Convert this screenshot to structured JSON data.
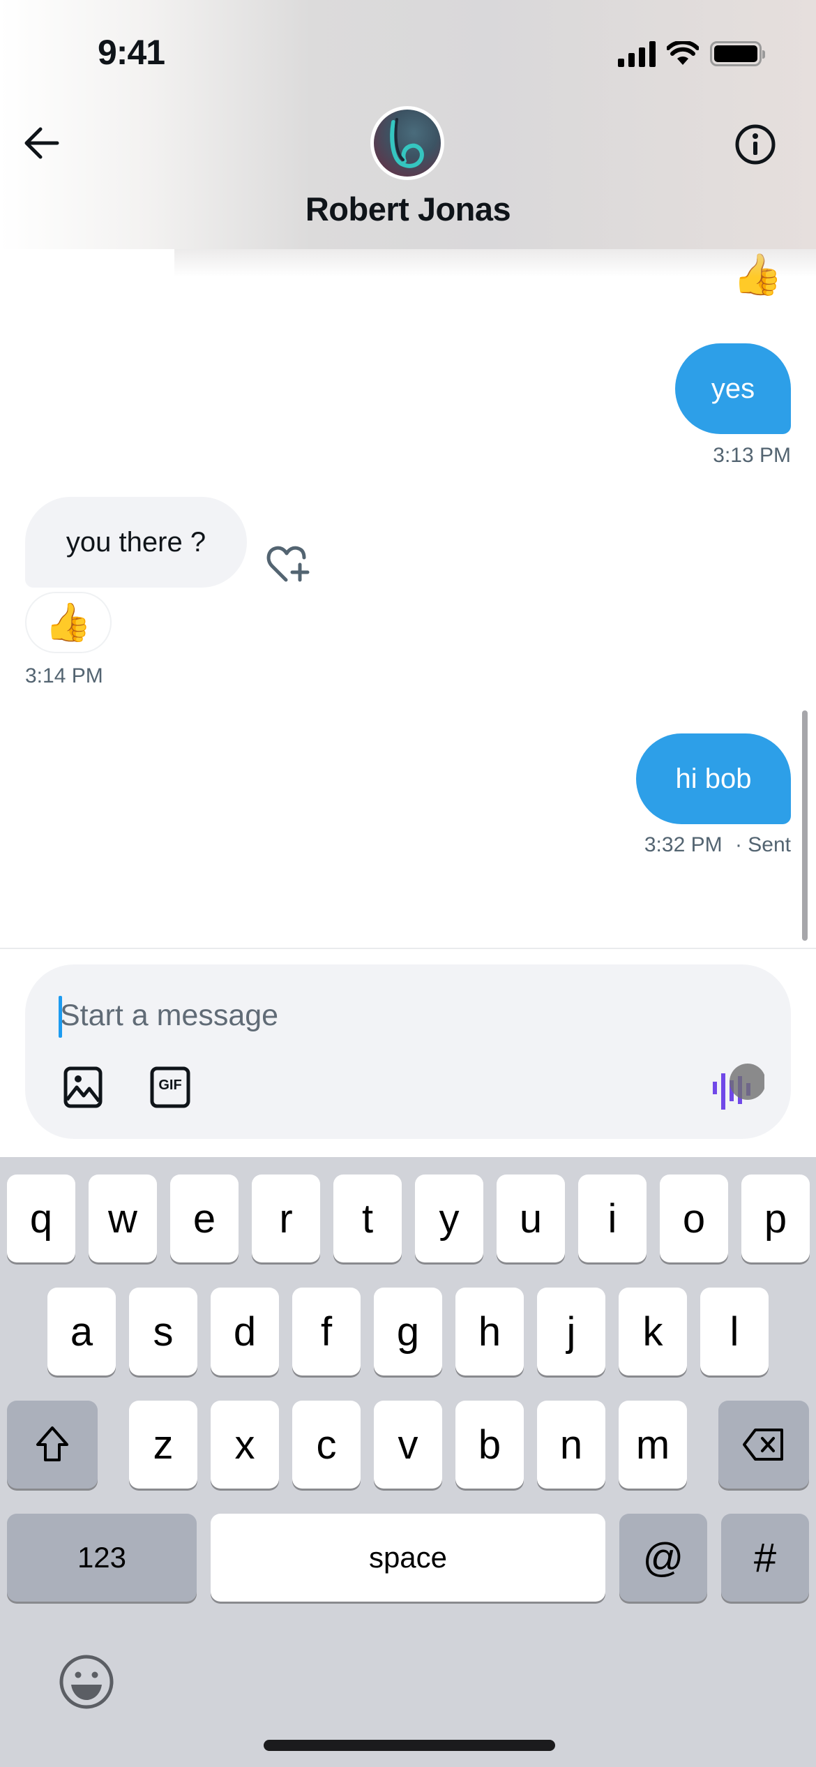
{
  "status_bar": {
    "time": "9:41",
    "icons": [
      "cellular-signal-icon",
      "wifi-icon",
      "battery-icon"
    ]
  },
  "header": {
    "contact_name": "Robert Jonas",
    "back_icon": "arrow-left-icon",
    "info_icon": "info-circle-icon",
    "avatar": "contact-avatar"
  },
  "conversation": {
    "top_reaction": "👍",
    "messages": [
      {
        "direction": "outgoing",
        "text": "yes",
        "time": "3:13 PM"
      },
      {
        "direction": "incoming",
        "text": "you there ?",
        "reaction": "👍",
        "time": "3:14 PM",
        "reaction_action_icon": "heart-plus-icon"
      },
      {
        "direction": "outgoing",
        "text": "hi bob",
        "time": "3:32 PM",
        "status": "· Sent"
      }
    ]
  },
  "composer": {
    "placeholder": "Start a message",
    "value": "",
    "media_icon": "image-icon",
    "gif_label": "GIF",
    "voice_icon": "voice-waveform-icon"
  },
  "keyboard": {
    "row1": [
      "q",
      "w",
      "e",
      "r",
      "t",
      "y",
      "u",
      "i",
      "o",
      "p"
    ],
    "row2": [
      "a",
      "s",
      "d",
      "f",
      "g",
      "h",
      "j",
      "k",
      "l"
    ],
    "row3": [
      "z",
      "x",
      "c",
      "v",
      "b",
      "n",
      "m"
    ],
    "shift_icon": "shift-arrow-icon",
    "delete_icon": "backspace-icon",
    "numbers_label": "123",
    "space_label": "space",
    "at_label": "@",
    "hash_label": "#",
    "emoji_icon": "emoji-face-icon"
  },
  "colors": {
    "accent_blue": "#2d9fe8",
    "incoming_bubble": "#f2f3f6",
    "timestamp_gray": "#536471",
    "keyboard_bg": "#d1d3d9",
    "voice_purple": "#7048e8"
  }
}
